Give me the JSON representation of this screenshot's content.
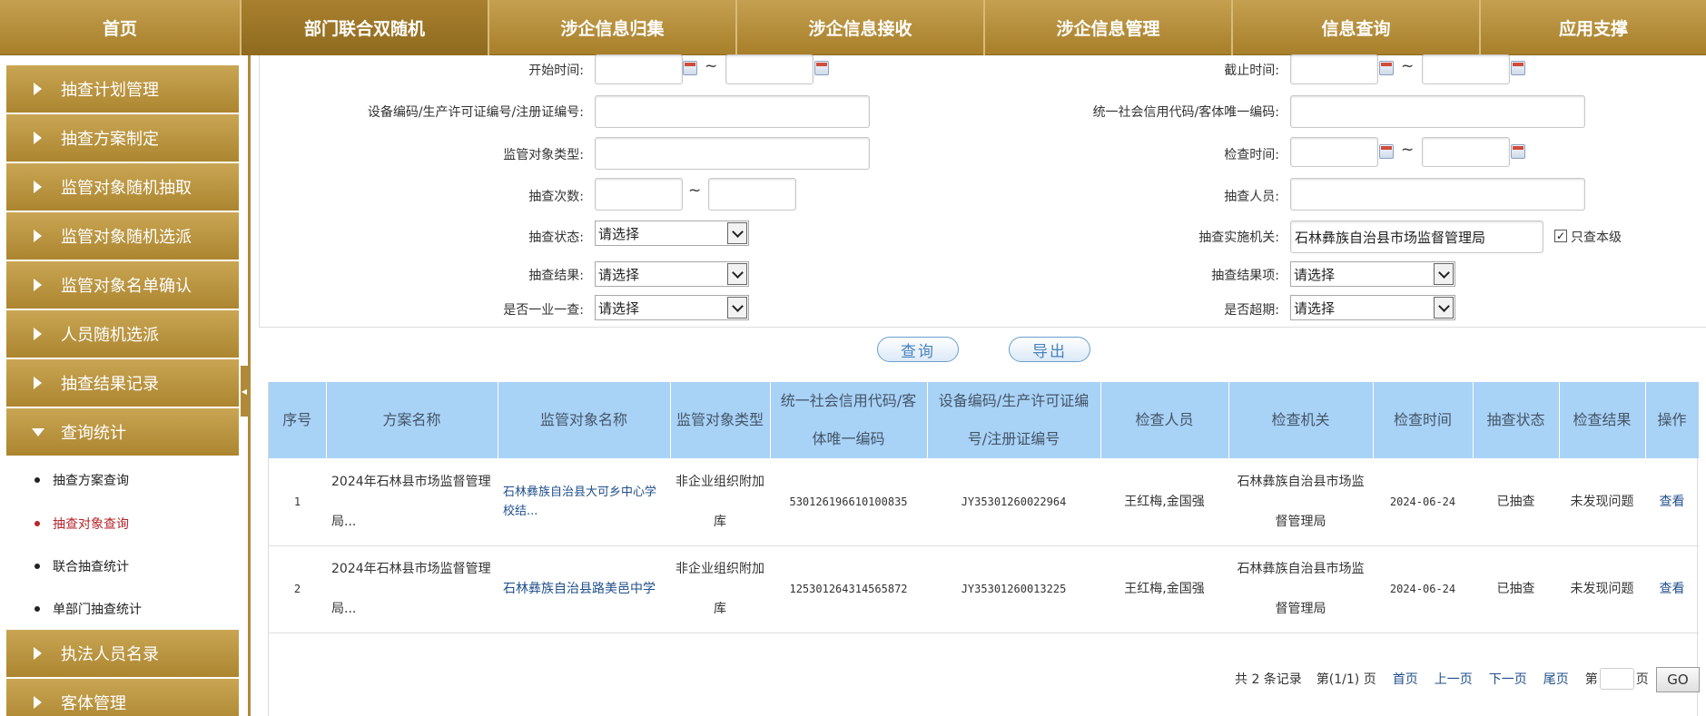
{
  "topnav": [
    {
      "label": "首页",
      "w": 266
    },
    {
      "label": "部门联合双随机",
      "w": 273
    },
    {
      "label": "涉企信息归集",
      "w": 273
    },
    {
      "label": "涉企信息接收",
      "w": 273
    },
    {
      "label": "涉企信息管理",
      "w": 273
    },
    {
      "label": "信息查询",
      "w": 273
    },
    {
      "label": "应用支撑",
      "w": 248
    }
  ],
  "sidebar": {
    "items": [
      "抽查计划管理",
      "抽查方案制定",
      "监管对象随机抽取",
      "监管对象随机选派",
      "监管对象名单确认",
      "人员随机选派",
      "抽查结果记录",
      "查询统计"
    ],
    "sub_items": [
      "抽查方案查询",
      "抽查对象查询",
      "联合抽查统计",
      "单部门抽查统计"
    ],
    "bottom_items": [
      "执法人员名录",
      "客体管理"
    ]
  },
  "form": {
    "start_time": "开始时间:",
    "end_time": "截止时间:",
    "device_code": "设备编码/生产许可证编号/注册证编号:",
    "credit_code": "统一社会信用代码/客体唯一编码:",
    "object_type": "监管对象类型:",
    "check_time": "检查时间:",
    "check_count": "抽查次数:",
    "inspector": "抽查人员:",
    "check_status": "抽查状态:",
    "org": "抽查实施机关:",
    "org_value": "石林彝族自治县市场监督管理局",
    "only_self": "只查本级",
    "check_result": "抽查结果:",
    "result_item": "抽查结果项:",
    "one_check": "是否一业一查:",
    "overdue": "是否超期:",
    "placeholder": "请选择",
    "tilde": "~"
  },
  "buttons": {
    "query": "查询",
    "export": "导出"
  },
  "table": {
    "headers": [
      "序号",
      "方案名称",
      "监管对象名称",
      "监管对象类型",
      "统一社会信用代码/客体唯一编码",
      "设备编码/生产许可证编号/注册证编号",
      "检查人员",
      "检查机关",
      "检查时间",
      "抽查状态",
      "检查结果",
      "操作"
    ],
    "rows": [
      {
        "no": "1",
        "plan": "2024年石林县市场监督管理局...",
        "object": "石林彝族自治县大可乡中心学校结...",
        "type": "非企业组织附加库",
        "credit": "530126196610100835",
        "device": "JY35301260022964",
        "inspectors": "王红梅,金国强",
        "org": "石林彝族自治县市场监督管理局",
        "date": "2024-06-24",
        "status": "已抽查",
        "result": "未发现问题",
        "action": "查看"
      },
      {
        "no": "2",
        "plan": "2024年石林县市场监督管理局...",
        "object": "石林彝族自治县路美邑中学",
        "type": "非企业组织附加库",
        "credit": "125301264314565872",
        "device": "JY35301260013225",
        "inspectors": "王红梅,金国强",
        "org": "石林彝族自治县市场监督管理局",
        "date": "2024-06-24",
        "status": "已抽查",
        "result": "未发现问题",
        "action": "查看"
      }
    ]
  },
  "pager": {
    "total": "共 2 条记录",
    "page": "第(1/1) 页",
    "first": "首页",
    "prev": "上一页",
    "next": "下一页",
    "last": "尾页",
    "jump_pre": "第",
    "jump_post": "页",
    "go": "GO"
  }
}
